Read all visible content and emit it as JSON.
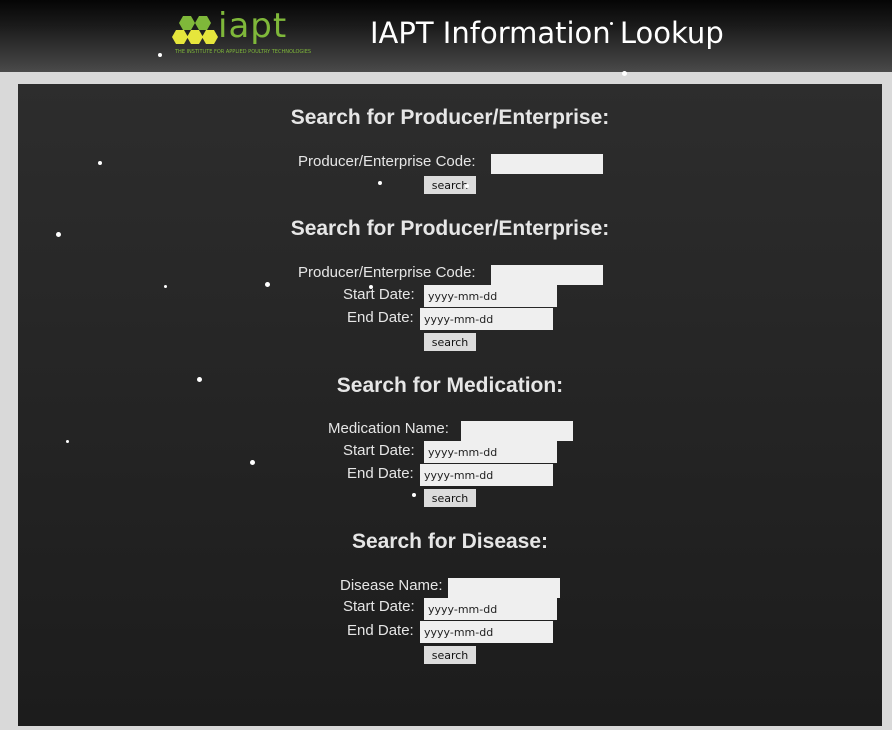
{
  "header": {
    "logo_text": "iapt",
    "logo_tagline": "THE INSTITUTE FOR APPLIED POULTRY TECHNOLOGIES",
    "title": "IAPT Information Lookup"
  },
  "sections": [
    {
      "heading": "Search for Producer/Enterprise:",
      "fields": {
        "code_label": "Producer/Enterprise Code:",
        "code_value": ""
      },
      "search_label": "search"
    },
    {
      "heading": "Search for Producer/Enterprise:",
      "fields": {
        "code_label": "Producer/Enterprise Code:",
        "code_value": "",
        "start_label": "Start Date:",
        "start_placeholder": "yyyy-mm-dd",
        "end_label": "End Date:",
        "end_placeholder": "yyyy-mm-dd"
      },
      "search_label": "search"
    },
    {
      "heading": "Search for Medication:",
      "fields": {
        "name_label": "Medication Name:",
        "name_value": "",
        "start_label": "Start Date:",
        "start_placeholder": "yyyy-mm-dd",
        "end_label": "End Date:",
        "end_placeholder": "yyyy-mm-dd"
      },
      "search_label": "search"
    },
    {
      "heading": "Search for Disease:",
      "fields": {
        "name_label": "Disease Name:",
        "name_value": "",
        "start_label": "Start Date:",
        "start_placeholder": "yyyy-mm-dd",
        "end_label": "End Date:",
        "end_placeholder": "yyyy-mm-dd"
      },
      "search_label": "search"
    }
  ],
  "colors": {
    "logo_green": "#7fb83a",
    "logo_yellow": "#e6e63c",
    "panel_bg": "#262626",
    "field_bg": "#efefef",
    "button_bg": "#dcdcdc"
  }
}
